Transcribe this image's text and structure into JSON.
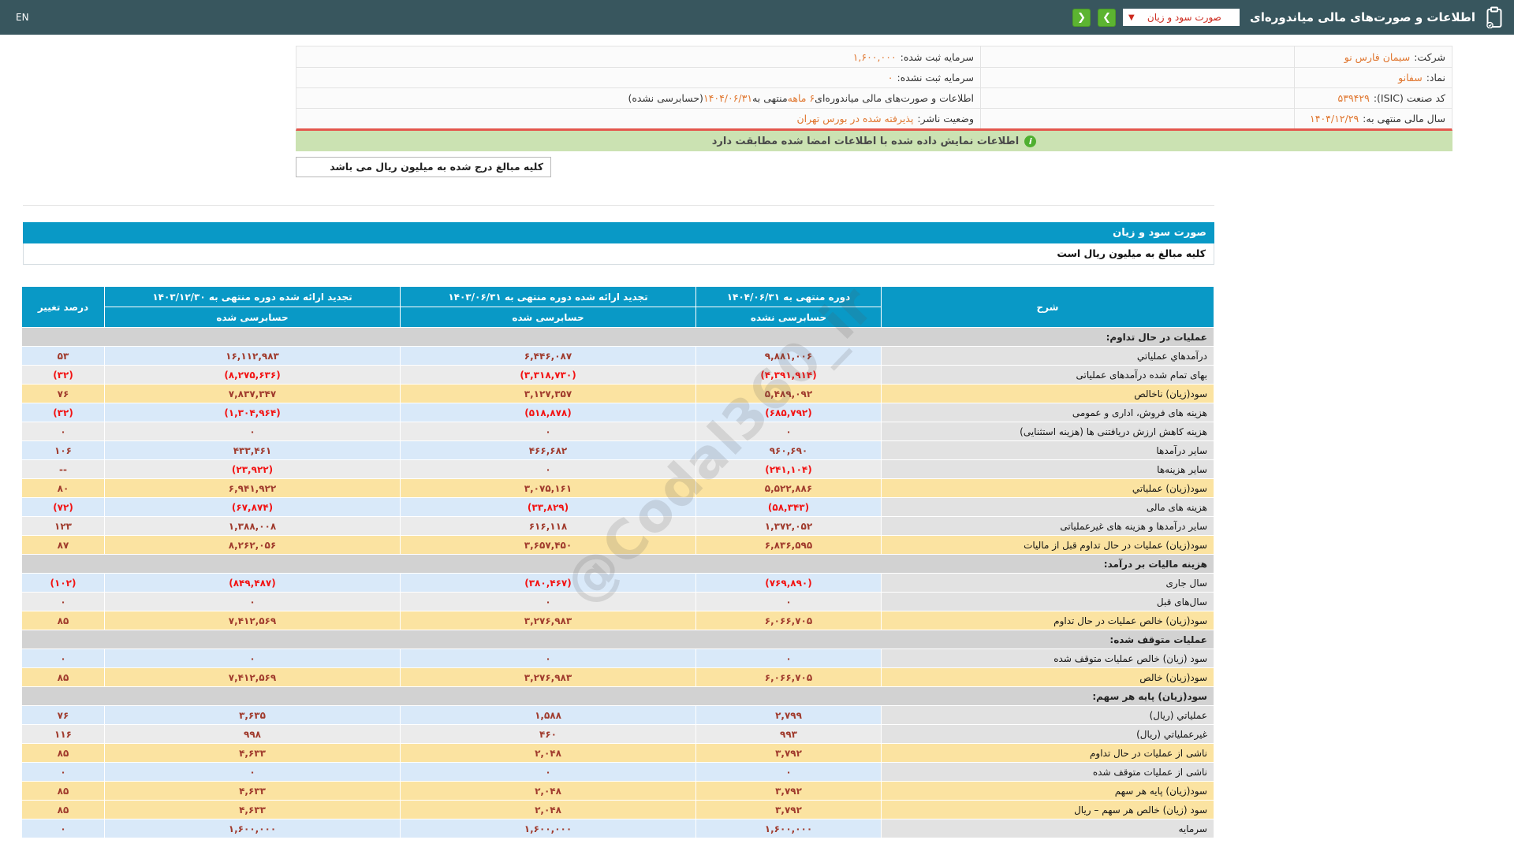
{
  "topbar": {
    "en_label": "EN",
    "title": "اطلاعات و صورت‌های مالی میاندوره‌ای",
    "dropdown_value": "صورت سود و زیان",
    "dropdown_caret": "▼",
    "next_label": "❯",
    "prev_label": "❮"
  },
  "info": {
    "row1": {
      "right_label": "شرکت:",
      "right_value": "سیمان فارس نو",
      "left_label": "سرمایه ثبت شده:",
      "left_value": "۱,۶۰۰,۰۰۰"
    },
    "row2": {
      "right_label": "نماد:",
      "right_value": "سفانو",
      "left_label": "سرمایه ثبت نشده:",
      "left_value": "۰"
    },
    "row3": {
      "right_label": "کد صنعت (ISIC):",
      "right_value": "۵۳۹۴۲۹",
      "left_p1": "اطلاعات و صورت‌های مالی میاندوره‌ای ",
      "left_p2": "۶ ماهه",
      "left_p3": " منتهی به ",
      "left_p4": "۱۴۰۴/۰۶/۳۱",
      "left_p5": "(حسابرسی نشده)"
    },
    "row4": {
      "right_label": "سال مالی منتهی به:",
      "right_value": "۱۴۰۴/۱۲/۲۹",
      "left_label": "وضعیت ناشر:",
      "left_value": "پذیرفته شده در بورس تهران"
    },
    "banner_text": "اطلاعات نمایش داده شده با اطلاعات امضا شده مطابقت دارد",
    "banner_icon": "i",
    "note_box": "کلیه مبالغ درج شده به میلیون ریال می باشد"
  },
  "statement": {
    "title": "صورت سود و زیان",
    "unit_note": "کلیه مبالغ به میلیون ریال است",
    "watermark": "@Codal360_ir",
    "table": {
      "headers": {
        "desc": "شرح",
        "col_current_period": "دوره منتهی به ۱۴۰۴/۰۶/۳۱",
        "col_current_audit": "حسابرسی نشده",
        "col_restated_6m_period": "تجدید ارائه شده دوره منتهی به ۱۴۰۳/۰۶/۳۱",
        "col_restated_6m_audit": "حسابرسی شده",
        "col_restated_year_period": "تجدید ارائه شده دوره منتهی به ۱۴۰۳/۱۲/۳۰",
        "col_restated_year_audit": "حسابرسی شده",
        "pct": "درصد تغییر"
      },
      "rows": [
        {
          "type": "section",
          "label": "عملیات در حال تداوم:"
        },
        {
          "type": "blue",
          "label": "درآمدهاي عملياتي",
          "current": "۹,۸۸۱,۰۰۶",
          "restated_6m": "۶,۴۴۶,۰۸۷",
          "restated_year": "۱۶,۱۱۲,۹۸۳",
          "pct": "۵۳"
        },
        {
          "type": "gray",
          "label": "بهای تمام شده درآمدهای عملیاتی",
          "current": "(۴,۳۹۱,۹۱۴)",
          "restated_6m": "(۳,۳۱۸,۷۳۰)",
          "restated_year": "(۸,۲۷۵,۶۳۶)",
          "pct": "(۳۲)"
        },
        {
          "type": "yellow",
          "label": "سود(زیان) ناخالص",
          "current": "۵,۴۸۹,۰۹۲",
          "restated_6m": "۳,۱۲۷,۳۵۷",
          "restated_year": "۷,۸۳۷,۳۴۷",
          "pct": "۷۶"
        },
        {
          "type": "blue",
          "label": "هزینه های فروش، اداری و عمومی",
          "current": "(۶۸۵,۷۹۲)",
          "restated_6m": "(۵۱۸,۸۷۸)",
          "restated_year": "(۱,۳۰۴,۹۶۴)",
          "pct": "(۳۲)"
        },
        {
          "type": "gray",
          "label": "هزینه کاهش ارزش دریافتنی ها (هزینه استثنایی)",
          "current": "۰",
          "restated_6m": "۰",
          "restated_year": "۰",
          "pct": "۰"
        },
        {
          "type": "blue",
          "label": "سایر درآمدها",
          "current": "۹۶۰,۶۹۰",
          "restated_6m": "۴۶۶,۶۸۲",
          "restated_year": "۴۳۳,۴۶۱",
          "pct": "۱۰۶"
        },
        {
          "type": "gray",
          "label": "سایر هزینه‌ها",
          "current": "(۲۴۱,۱۰۴)",
          "restated_6m": "۰",
          "restated_year": "(۲۳,۹۲۲)",
          "pct": "--"
        },
        {
          "type": "yellow",
          "label": "سود(زیان) عملياتي",
          "current": "۵,۵۲۲,۸۸۶",
          "restated_6m": "۳,۰۷۵,۱۶۱",
          "restated_year": "۶,۹۴۱,۹۲۲",
          "pct": "۸۰"
        },
        {
          "type": "blue",
          "label": "هزینه های مالی",
          "current": "(۵۸,۳۴۳)",
          "restated_6m": "(۳۳,۸۲۹)",
          "restated_year": "(۶۷,۸۷۴)",
          "pct": "(۷۲)"
        },
        {
          "type": "gray",
          "label": "سایر درآمدها و هزینه های غیرعملیاتی",
          "current": "۱,۳۷۲,۰۵۲",
          "restated_6m": "۶۱۶,۱۱۸",
          "restated_year": "۱,۳۸۸,۰۰۸",
          "pct": "۱۲۳"
        },
        {
          "type": "yellow",
          "label": "سود(زیان) عملیات در حال تداوم قبل از مالیات",
          "current": "۶,۸۳۶,۵۹۵",
          "restated_6m": "۳,۶۵۷,۴۵۰",
          "restated_year": "۸,۲۶۲,۰۵۶",
          "pct": "۸۷"
        },
        {
          "type": "section",
          "label": "هزینه مالیات بر درآمد:"
        },
        {
          "type": "blue",
          "label": "سال جاری",
          "current": "(۷۶۹,۸۹۰)",
          "restated_6m": "(۳۸۰,۴۶۷)",
          "restated_year": "(۸۴۹,۴۸۷)",
          "pct": "(۱۰۲)"
        },
        {
          "type": "gray",
          "label": "سال‌های قبل",
          "current": "۰",
          "restated_6m": "۰",
          "restated_year": "۰",
          "pct": "۰"
        },
        {
          "type": "yellow",
          "label": "سود(زیان) خالص عملیات در حال تداوم",
          "current": "۶,۰۶۶,۷۰۵",
          "restated_6m": "۳,۲۷۶,۹۸۳",
          "restated_year": "۷,۴۱۲,۵۶۹",
          "pct": "۸۵"
        },
        {
          "type": "section",
          "label": "عملیات متوقف شده:"
        },
        {
          "type": "blue",
          "label": "سود (زیان) خالص عملیات متوقف شده",
          "current": "۰",
          "restated_6m": "۰",
          "restated_year": "۰",
          "pct": "۰"
        },
        {
          "type": "yellow",
          "label": "سود(زیان) خالص",
          "current": "۶,۰۶۶,۷۰۵",
          "restated_6m": "۳,۲۷۶,۹۸۳",
          "restated_year": "۷,۴۱۲,۵۶۹",
          "pct": "۸۵"
        },
        {
          "type": "section",
          "label": "سود(زیان) پایه هر سهم:"
        },
        {
          "type": "blue",
          "label": "عملیاتي (ریال)",
          "current": "۲,۷۹۹",
          "restated_6m": "۱,۵۸۸",
          "restated_year": "۳,۶۳۵",
          "pct": "۷۶"
        },
        {
          "type": "gray",
          "label": "غیرعملیاتي (ریال)",
          "current": "۹۹۳",
          "restated_6m": "۴۶۰",
          "restated_year": "۹۹۸",
          "pct": "۱۱۶"
        },
        {
          "type": "yellow",
          "label": "ناشی از عملیات در حال تداوم",
          "current": "۳,۷۹۲",
          "restated_6m": "۲,۰۴۸",
          "restated_year": "۴,۶۳۳",
          "pct": "۸۵"
        },
        {
          "type": "blue",
          "label": "ناشی از عملیات متوقف شده",
          "current": "۰",
          "restated_6m": "۰",
          "restated_year": "۰",
          "pct": "۰"
        },
        {
          "type": "yellow",
          "label": "سود(زیان) پایه هر سهم",
          "current": "۳,۷۹۲",
          "restated_6m": "۲,۰۴۸",
          "restated_year": "۴,۶۳۳",
          "pct": "۸۵"
        },
        {
          "type": "yellow",
          "label": "سود (زیان) خالص هر سهم – ریال",
          "current": "۳,۷۹۲",
          "restated_6m": "۲,۰۴۸",
          "restated_year": "۴,۶۳۳",
          "pct": "۸۵"
        },
        {
          "type": "blue",
          "label": "سرمایه",
          "current": "۱,۶۰۰,۰۰۰",
          "restated_6m": "۱,۶۰۰,۰۰۰",
          "restated_year": "۱,۶۰۰,۰۰۰",
          "pct": "۰"
        }
      ]
    }
  },
  "colors": {
    "topbar_bg": "#38565e",
    "accent_blue": "#0999c6",
    "green_button": "#5cb431",
    "banner_green": "#cbe2b2",
    "red_divider": "#e4574d",
    "orange_value": "#e0762f",
    "positive_number": "#a03b2d",
    "negative_number": "#f21313",
    "row_blue": "#d9e9f9",
    "row_gray": "#ebebeb",
    "row_yellow": "#fbe3a1",
    "section_gray": "#d2d2d2"
  }
}
